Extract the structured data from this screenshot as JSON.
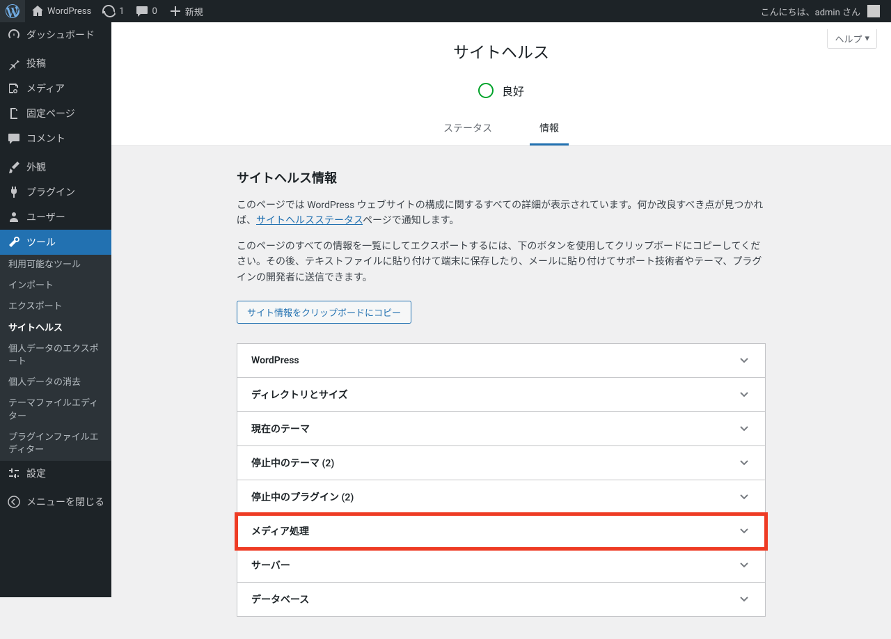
{
  "adminbar": {
    "site_name": "WordPress",
    "updates": "1",
    "comments": "0",
    "new": "新規",
    "greeting": "こんにちは、admin さん"
  },
  "menu": {
    "dashboard": "ダッシュボード",
    "posts": "投稿",
    "media": "メディア",
    "pages": "固定ページ",
    "comments": "コメント",
    "appearance": "外観",
    "plugins": "プラグイン",
    "users": "ユーザー",
    "tools": "ツール",
    "settings": "設定",
    "collapse": "メニューを閉じる",
    "tools_sub": {
      "available": "利用可能なツール",
      "import": "インポート",
      "export": "エクスポート",
      "site_health": "サイトヘルス",
      "export_personal": "個人データのエクスポート",
      "erase_personal": "個人データの消去",
      "theme_editor": "テーマファイルエディター",
      "plugin_editor": "プラグインファイルエディター"
    }
  },
  "header": {
    "help": "ヘルプ",
    "title": "サイトヘルス",
    "status_label": "良好",
    "tab_status": "ステータス",
    "tab_info": "情報"
  },
  "content": {
    "heading": "サイトヘルス情報",
    "para1_a": "このページでは WordPress ウェブサイトの構成に関するすべての詳細が表示されています。何か改良すべき点が見つかれば、",
    "para1_link": "サイトヘルスステータス",
    "para1_b": "ページで通知します。",
    "para2": "このページのすべての情報を一覧にしてエクスポートするには、下のボタンを使用してクリップボードにコピーしてください。その後、テキストファイルに貼り付けて端末に保存したり、メールに貼り付けてサポート技術者やテーマ、プラグインの開発者に送信できます。",
    "copy_button": "サイト情報をクリップボードにコピー"
  },
  "accordion": [
    {
      "label": "WordPress",
      "highlighted": false
    },
    {
      "label": "ディレクトリとサイズ",
      "highlighted": false
    },
    {
      "label": "現在のテーマ",
      "highlighted": false
    },
    {
      "label": "停止中のテーマ (2)",
      "highlighted": false
    },
    {
      "label": "停止中のプラグイン (2)",
      "highlighted": false
    },
    {
      "label": "メディア処理",
      "highlighted": true
    },
    {
      "label": "サーバー",
      "highlighted": false
    },
    {
      "label": "データベース",
      "highlighted": false
    }
  ]
}
